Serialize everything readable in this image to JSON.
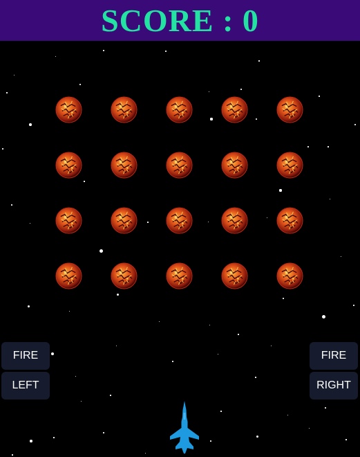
{
  "score": {
    "label": "SCORE",
    "separator": ":",
    "value": "0"
  },
  "controls": {
    "left_fire": "FIRE",
    "left_move": "LEFT",
    "right_fire": "FIRE",
    "right_move": "RIGHT"
  },
  "enemies": {
    "rows": 4,
    "columns": 5,
    "icon": "molten-planet-icon"
  },
  "player": {
    "icon": "fighter-jet-icon"
  },
  "colors": {
    "score_bar": "#3a0a78",
    "score_text": "#22e3a2",
    "background": "#000000",
    "button_bg": "#161c2e",
    "ship": "#1e9be0"
  }
}
